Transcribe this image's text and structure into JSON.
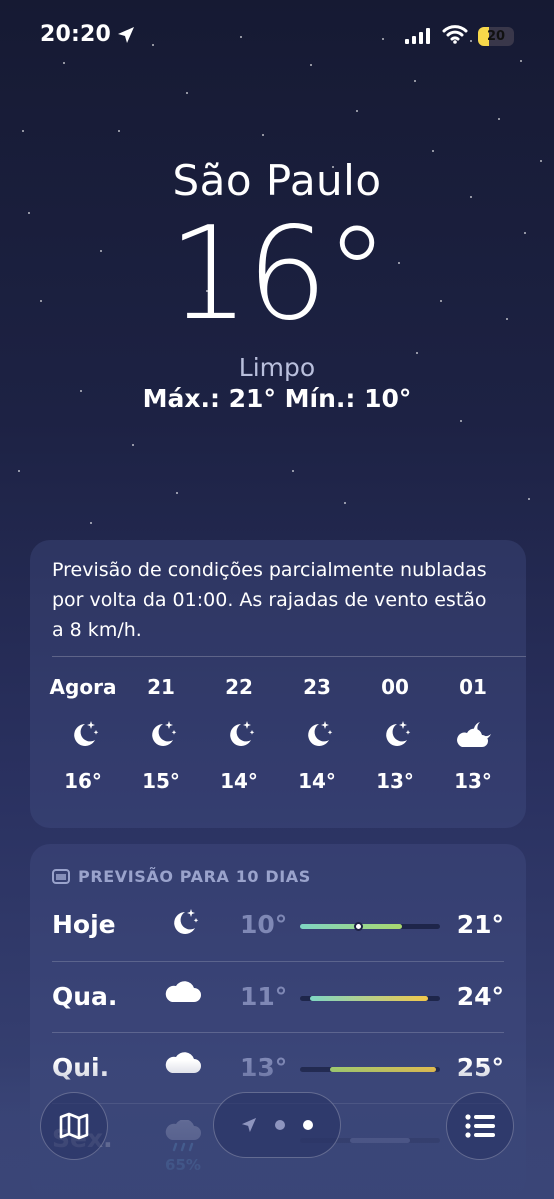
{
  "status_bar": {
    "time": "20:20",
    "battery": "20",
    "icons": [
      "location-arrow-icon",
      "cellular-signal-icon",
      "wifi-icon",
      "battery-icon"
    ]
  },
  "hero": {
    "city": "São Paulo",
    "temperature": "16°",
    "condition": "Limpo",
    "hilo": "Máx.: 21°  Mín.: 10°"
  },
  "hourly": {
    "summary": "Previsão de condições parcialmente nubladas por volta da 01:00. As rajadas de vento estão a 8 km/h.",
    "items": [
      {
        "label": "Agora",
        "icon": "moon-stars-icon",
        "temp": "16°"
      },
      {
        "label": "21",
        "icon": "moon-stars-icon",
        "temp": "15°"
      },
      {
        "label": "22",
        "icon": "moon-stars-icon",
        "temp": "14°"
      },
      {
        "label": "23",
        "icon": "moon-stars-icon",
        "temp": "14°"
      },
      {
        "label": "00",
        "icon": "moon-stars-icon",
        "temp": "13°"
      },
      {
        "label": "01",
        "icon": "cloud-moon-icon",
        "temp": "13°"
      }
    ]
  },
  "ten_day": {
    "header": "PREVISÃO PARA 10 DIAS",
    "days": [
      {
        "day": "Hoje",
        "icon": "moon-stars-icon",
        "low": "10°",
        "high": "21°",
        "precip": ""
      },
      {
        "day": "Qua.",
        "icon": "cloud-icon",
        "low": "11°",
        "high": "24°",
        "precip": ""
      },
      {
        "day": "Qui.",
        "icon": "cloud-icon",
        "low": "13°",
        "high": "25°",
        "precip": ""
      },
      {
        "day": "Sex.",
        "icon": "cloud-rain-icon",
        "low": "",
        "high": "",
        "precip": "65%"
      }
    ]
  },
  "colors": {
    "bar_cool": "#7fd6c4",
    "bar_mild": "#a9d86e",
    "bar_warm": "#f2c84b",
    "precip": "#6ec0f0"
  },
  "toolbar": {
    "left": "map-icon",
    "right": "list-icon",
    "pager": [
      "location-arrow-icon",
      "page-dot",
      "page-dot-active"
    ]
  }
}
